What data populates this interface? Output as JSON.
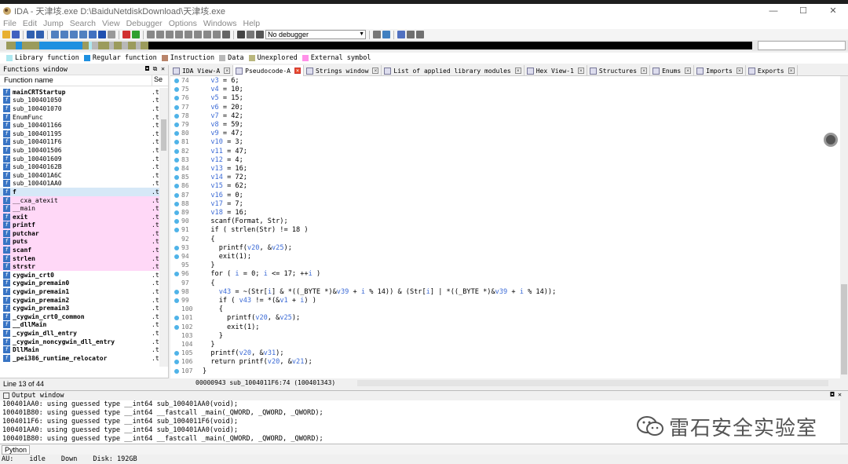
{
  "window": {
    "title": "IDA - 天津垓.exe D:\\BaiduNetdiskDownload\\天津垓.exe",
    "min": "—",
    "max": "☐",
    "close": "✕"
  },
  "menu": [
    "File",
    "Edit",
    "Jump",
    "Search",
    "View",
    "Debugger",
    "Options",
    "Windows",
    "Help"
  ],
  "toolbar": {
    "debugger_select": "No debugger"
  },
  "legend": [
    {
      "label": "Library function",
      "color": "#aee8f0"
    },
    {
      "label": "Regular function",
      "color": "#1e90e0"
    },
    {
      "label": "Instruction",
      "color": "#b9846a"
    },
    {
      "label": "Data",
      "color": "#b8b8b8"
    },
    {
      "label": "Unexplored",
      "color": "#b9b67d"
    },
    {
      "label": "External symbol",
      "color": "#ff90e8"
    }
  ],
  "functions_panel": {
    "title": "Functions window",
    "col_name": "Function name",
    "col_segment": "Se",
    "status": "Line 13 of 44",
    "items": [
      {
        "name": "mainCRTStartup",
        "seg": ".t",
        "type": "bold"
      },
      {
        "name": "sub_100401050",
        "seg": ".t",
        "type": "normal"
      },
      {
        "name": "sub_100401070",
        "seg": ".t",
        "type": "normal"
      },
      {
        "name": "EnumFunc",
        "seg": ".t",
        "type": "normal"
      },
      {
        "name": "sub_100401166",
        "seg": ".t",
        "type": "normal"
      },
      {
        "name": "sub_100401195",
        "seg": ".t",
        "type": "normal"
      },
      {
        "name": "sub_1004011F6",
        "seg": ".t",
        "type": "normal"
      },
      {
        "name": "sub_100401506",
        "seg": ".t",
        "type": "normal"
      },
      {
        "name": "sub_100401609",
        "seg": ".t",
        "type": "normal"
      },
      {
        "name": "sub_10040162B",
        "seg": ".t",
        "type": "normal"
      },
      {
        "name": "sub_100401A6C",
        "seg": ".t",
        "type": "normal"
      },
      {
        "name": "sub_100401AA0",
        "seg": ".t",
        "type": "normal"
      },
      {
        "name": "f",
        "seg": ".t",
        "type": "sel"
      },
      {
        "name": "__cxa_atexit",
        "seg": ".t",
        "type": "lib"
      },
      {
        "name": "__main",
        "seg": ".t",
        "type": "lib"
      },
      {
        "name": "exit",
        "seg": ".t",
        "type": "libbold"
      },
      {
        "name": "printf",
        "seg": ".t",
        "type": "libbold"
      },
      {
        "name": "putchar",
        "seg": ".t",
        "type": "libbold"
      },
      {
        "name": "puts",
        "seg": ".t",
        "type": "libbold"
      },
      {
        "name": "scanf",
        "seg": ".t",
        "type": "libbold"
      },
      {
        "name": "strlen",
        "seg": ".t",
        "type": "libbold"
      },
      {
        "name": "strstr",
        "seg": ".t",
        "type": "libbold"
      },
      {
        "name": "cygwin_crt0",
        "seg": ".t",
        "type": "bold"
      },
      {
        "name": "cygwin_premain0",
        "seg": ".t",
        "type": "bold"
      },
      {
        "name": "cygwin_premain1",
        "seg": ".t",
        "type": "bold"
      },
      {
        "name": "cygwin_premain2",
        "seg": ".t",
        "type": "bold"
      },
      {
        "name": "cygwin_premain3",
        "seg": ".t",
        "type": "bold"
      },
      {
        "name": "_cygwin_crt0_common",
        "seg": ".t",
        "type": "bold"
      },
      {
        "name": "__dllMain",
        "seg": ".t",
        "type": "bold"
      },
      {
        "name": "_cygwin_dll_entry",
        "seg": ".t",
        "type": "bold"
      },
      {
        "name": "_cygwin_noncygwin_dll_entry",
        "seg": ".t",
        "type": "bold"
      },
      {
        "name": "DllMain",
        "seg": ".t",
        "type": "bold"
      },
      {
        "name": "_pei386_runtime_relocator",
        "seg": ".t",
        "type": "bold"
      }
    ]
  },
  "tabs": [
    {
      "label": "IDA View-A",
      "active": false
    },
    {
      "label": "Pseudocode-A",
      "active": true
    },
    {
      "label": "Strings window",
      "active": false
    },
    {
      "label": "List of applied library modules",
      "active": false
    },
    {
      "label": "Hex View-1",
      "active": false
    },
    {
      "label": "Structures",
      "active": false
    },
    {
      "label": "Enums",
      "active": false
    },
    {
      "label": "Imports",
      "active": false
    },
    {
      "label": "Exports",
      "active": false
    }
  ],
  "code": {
    "status": "00000943 sub_1004011F6:74 (100401343)",
    "lines": [
      {
        "n": "74",
        "dot": true,
        "text": "  v3 = 6;"
      },
      {
        "n": "75",
        "dot": true,
        "text": "  v4 = 10;"
      },
      {
        "n": "76",
        "dot": true,
        "text": "  v5 = 15;"
      },
      {
        "n": "77",
        "dot": true,
        "text": "  v6 = 20;"
      },
      {
        "n": "78",
        "dot": true,
        "text": "  v7 = 42;"
      },
      {
        "n": "79",
        "dot": true,
        "text": "  v8 = 59;"
      },
      {
        "n": "80",
        "dot": true,
        "text": "  v9 = 47;"
      },
      {
        "n": "81",
        "dot": true,
        "text": "  v10 = 3;"
      },
      {
        "n": "82",
        "dot": true,
        "text": "  v11 = 47;"
      },
      {
        "n": "83",
        "dot": true,
        "text": "  v12 = 4;"
      },
      {
        "n": "84",
        "dot": true,
        "text": "  v13 = 16;"
      },
      {
        "n": "85",
        "dot": true,
        "text": "  v14 = 72;"
      },
      {
        "n": "86",
        "dot": true,
        "text": "  v15 = 62;"
      },
      {
        "n": "87",
        "dot": true,
        "text": "  v16 = 0;"
      },
      {
        "n": "88",
        "dot": true,
        "text": "  v17 = 7;"
      },
      {
        "n": "89",
        "dot": true,
        "text": "  v18 = 16;"
      },
      {
        "n": "90",
        "dot": true,
        "text": "  scanf(Format, Str);"
      },
      {
        "n": "91",
        "dot": true,
        "text": "  if ( strlen(Str) != 18 )"
      },
      {
        "n": "92",
        "dot": false,
        "text": "  {"
      },
      {
        "n": "93",
        "dot": true,
        "text": "    printf(v20, &v25);"
      },
      {
        "n": "94",
        "dot": true,
        "text": "    exit(1);"
      },
      {
        "n": "95",
        "dot": false,
        "text": "  }"
      },
      {
        "n": "96",
        "dot": true,
        "text": "  for ( i = 0; i <= 17; ++i )"
      },
      {
        "n": "97",
        "dot": false,
        "text": "  {"
      },
      {
        "n": "98",
        "dot": true,
        "text": "    v43 = ~(Str[i] & *((_BYTE *)&v39 + i % 14)) & (Str[i] | *((_BYTE *)&v39 + i % 14));"
      },
      {
        "n": "99",
        "dot": true,
        "text": "    if ( v43 != *(&v1 + i) )"
      },
      {
        "n": "100",
        "dot": false,
        "text": "    {"
      },
      {
        "n": "101",
        "dot": true,
        "text": "      printf(v20, &v25);"
      },
      {
        "n": "102",
        "dot": true,
        "text": "      exit(1);"
      },
      {
        "n": "103",
        "dot": false,
        "text": "    }"
      },
      {
        "n": "104",
        "dot": false,
        "text": "  }"
      },
      {
        "n": "105",
        "dot": true,
        "text": "  printf(v20, &v31);"
      },
      {
        "n": "106",
        "dot": true,
        "text": "  return printf(v20, &v21);"
      },
      {
        "n": "107",
        "dot": true,
        "text": "}"
      }
    ]
  },
  "output": {
    "title": "Output window",
    "lines": [
      "100401AA0: using guessed type __int64 sub_100401AA0(void);",
      "100401B80: using guessed type __int64 __fastcall _main(_QWORD, _QWORD, _QWORD);",
      "1004011F6: using guessed type __int64 sub_1004011F6(void);",
      "100401AA0: using guessed type __int64 sub_100401AA0(void);",
      "100401B80: using guessed type __int64 __fastcall _main(_QWORD, _QWORD, _QWORD);"
    ]
  },
  "watermark": {
    "text": "雷石安全实验室"
  },
  "python_button": "Python",
  "status": {
    "au": "AU:",
    "state": "idle",
    "dir": "Down",
    "disk": "Disk: 192GB"
  }
}
